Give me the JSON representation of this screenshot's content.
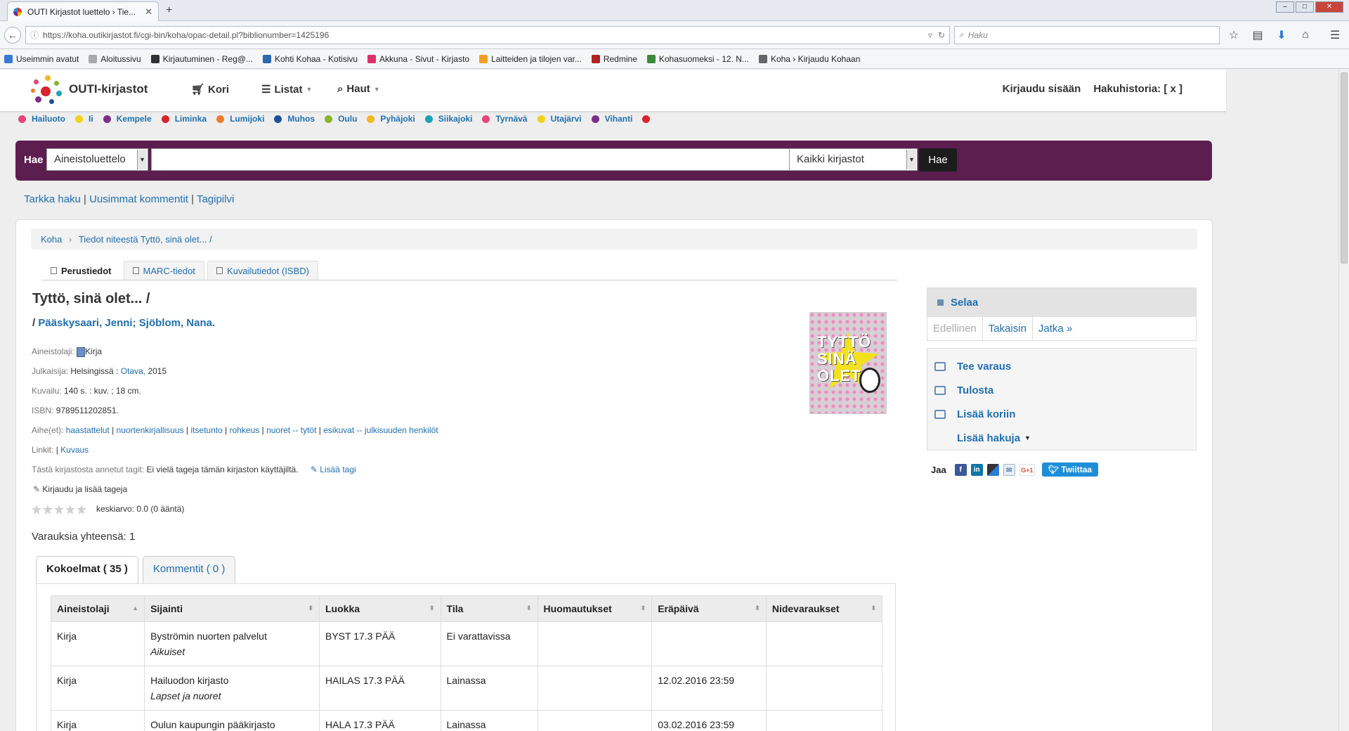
{
  "browser": {
    "tab_title": "OUTI Kirjastot luettelo › Tie...",
    "url": "https://koha.outikirjastot.fi/cgi-bin/koha/opac-detail.pl?biblionumber=1425196",
    "search_placeholder": "Haku",
    "bookmarks": [
      {
        "label": "Useimmin avatut",
        "color": "#3a7bd5"
      },
      {
        "label": "Aloitussivu",
        "color": "#aaaaaa"
      },
      {
        "label": "Kirjautuminen - Reg@...",
        "color": "#333333"
      },
      {
        "label": "Kohti Kohaa - Kotisivu",
        "color": "#2a6ab0"
      },
      {
        "label": "Akkuna - Sivut - Kirjasto",
        "color": "#e0306a"
      },
      {
        "label": "Laitteiden ja tilojen var...",
        "color": "#f0a020"
      },
      {
        "label": "Redmine",
        "color": "#b02020"
      },
      {
        "label": "Kohasuomeksi - 12. N...",
        "color": "#3a8a3a"
      },
      {
        "label": "Koha › Kirjaudu Kohaan",
        "color": "#666666"
      }
    ]
  },
  "header": {
    "brand": "OUTI-kirjastot",
    "nav": [
      "Kori",
      "Listat",
      "Haut"
    ],
    "login": "Kirjaudu sisään",
    "history": "Hakuhistoria: [ x ]"
  },
  "libraries": [
    {
      "name": "Hailuoto",
      "color": "#e6457b"
    },
    {
      "name": "Ii",
      "color": "#f2d21b"
    },
    {
      "name": "Kempele",
      "color": "#7b2f86"
    },
    {
      "name": "Liminka",
      "color": "#d8242a"
    },
    {
      "name": "Lumijoki",
      "color": "#ee7d2b"
    },
    {
      "name": "Muhos",
      "color": "#1e4f9c"
    },
    {
      "name": "Oulu",
      "color": "#87b52a"
    },
    {
      "name": "Pyhäjoki",
      "color": "#f2b724"
    },
    {
      "name": "Siikajoki",
      "color": "#1aa3b8"
    },
    {
      "name": "Tyrnävä",
      "color": "#e6457b"
    },
    {
      "name": "Utajärvi",
      "color": "#f2d21b"
    },
    {
      "name": "Vihanti",
      "color": "#7b2f86"
    }
  ],
  "trailing_dot_color": "#d8242a",
  "search": {
    "label": "Hae",
    "index": "Aineistoluettelo",
    "library": "Kaikki kirjastot",
    "button": "Hae"
  },
  "minilinks": [
    "Tarkka haku",
    "Uusimmat kommentit",
    "Tagipilvi"
  ],
  "breadcrumb": {
    "home": "Koha",
    "current": "Tiedot niteestä Tyttö, sinä olet... /"
  },
  "view_tabs": [
    "Perustiedot",
    "MARC-tiedot",
    "Kuvailutiedot (ISBD)"
  ],
  "record": {
    "title": "Tyttö, sinä olet... /",
    "authors": [
      "Pääskysaari, Jenni;",
      "Sjöblom, Nana."
    ],
    "type_label": "Aineistolaji:",
    "type": "Kirja",
    "publisher_label": "Julkaisija:",
    "publisher_place": "Helsingissä :",
    "publisher": "Otava,",
    "year": "2015",
    "desc_label": "Kuvailu:",
    "desc": "140 s. : kuv. ; 18 cm.",
    "isbn_label": "ISBN:",
    "isbn": "9789511202851.",
    "subjects_label": "Aihe(et):",
    "subjects": [
      "haastattelut",
      "nuortenkirjallisuus",
      "itsetunto",
      "rohkeus",
      "nuoret -- tytöt",
      "esikuvat -- julkisuuden henkilöt"
    ],
    "links_label": "Linkit:",
    "links": "Kuvaus",
    "tags_label": "Tästä kirjastosta annetut tagit:",
    "tags_text": "Ei vielä tageja tämän kirjaston käyttäjiltä.",
    "add_tag": "Lisää tagi",
    "login_tags": "Kirjaudu ja lisää tageja",
    "rating": "keskiarvo: 0.0 (0 ääntä)",
    "cover_text": "TYTTÖ SINÄ OLET..."
  },
  "reservations": "Varauksia yhteensä: 1",
  "holdings_tabs": [
    "Kokoelmat ( 35 )",
    "Kommentit ( 0 )"
  ],
  "table": {
    "headers": [
      "Aineistolaji",
      "Sijainti",
      "Luokka",
      "Tila",
      "Huomautukset",
      "Eräpäivä",
      "Nidevaraukset"
    ],
    "rows": [
      {
        "type": "Kirja",
        "loc": "Byströmin nuorten palvelut",
        "sub": "Aikuiset",
        "cls": "BYST 17.3 PÄÄ",
        "status": "Ei varattavissa",
        "notes": "",
        "due": "",
        "holds": ""
      },
      {
        "type": "Kirja",
        "loc": "Hailuodon kirjasto",
        "sub": "Lapset ja nuoret",
        "cls": "HAILAS 17.3 PÄÄ",
        "status": "Lainassa",
        "notes": "",
        "due": "12.02.2016 23:59",
        "holds": ""
      },
      {
        "type": "Kirja",
        "loc": "Oulun kaupungin pääkirjasto",
        "sub": "",
        "cls": "HALA 17.3 PÄÄ",
        "status": "Lainassa",
        "notes": "",
        "due": "03.02.2016 23:59",
        "holds": ""
      }
    ]
  },
  "browse": {
    "title": "Selaa",
    "prev": "Edellinen",
    "back": "Takaisin",
    "next": "Jatka »"
  },
  "actions": [
    "Tee varaus",
    "Tulosta",
    "Lisää koriin",
    "Lisää hakuja"
  ],
  "share": {
    "label": "Jaa",
    "tweet": "Twiittaa"
  }
}
